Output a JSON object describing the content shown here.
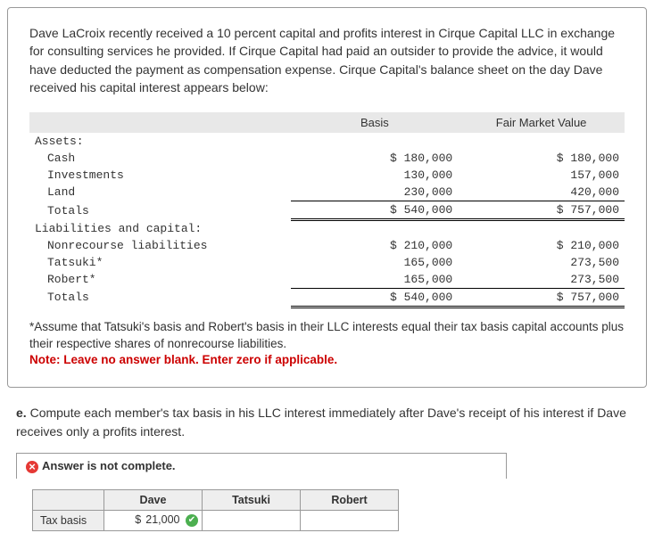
{
  "card": {
    "prompt": "Dave LaCroix recently received a 10 percent capital and profits interest in Cirque Capital LLC in exchange for consulting services he provided. If Cirque Capital had paid an outsider to provide the advice, it would have deducted the payment as compensation expense. Cirque Capital's balance sheet on the day Dave received his capital interest appears below:",
    "footnote": "*Assume that Tatsuki's basis and Robert's basis in their LLC interests equal their tax basis capital accounts plus their respective shares of nonrecourse liabilities.",
    "note": "Note: Leave no answer blank. Enter zero if applicable."
  },
  "bs": {
    "head": {
      "c1": "Basis",
      "c2": "Fair Market Value"
    },
    "rows": [
      {
        "label": "Assets:",
        "b": "",
        "f": ""
      },
      {
        "label": "Cash",
        "b": "$ 180,000",
        "f": "$ 180,000"
      },
      {
        "label": "Investments",
        "b": "130,000",
        "f": "157,000"
      },
      {
        "label": "Land",
        "b": "230,000",
        "f": "420,000"
      },
      {
        "label": "Totals",
        "b": "$ 540,000",
        "f": "$ 757,000"
      },
      {
        "label": "Liabilities and capital:",
        "b": "",
        "f": ""
      },
      {
        "label": "Nonrecourse liabilities",
        "b": "$ 210,000",
        "f": "$ 210,000"
      },
      {
        "label": "Tatsuki*",
        "b": "165,000",
        "f": "273,500"
      },
      {
        "label": "Robert*",
        "b": "165,000",
        "f": "273,500"
      },
      {
        "label": "Totals",
        "b": "$ 540,000",
        "f": "$ 757,000"
      }
    ]
  },
  "question": {
    "prefix": "e.",
    "text": " Compute each member's tax basis in his LLC interest immediately after Dave's receipt of his interest if Dave receives only a profits interest."
  },
  "feedback": "Answer is not complete.",
  "answer": {
    "cols": [
      "",
      "Dave",
      "Tatsuki",
      "Robert"
    ],
    "row_label": "Tax basis",
    "dave_prefix": "$",
    "dave_val": "21,000",
    "tatsuki_val": "",
    "robert_val": ""
  }
}
